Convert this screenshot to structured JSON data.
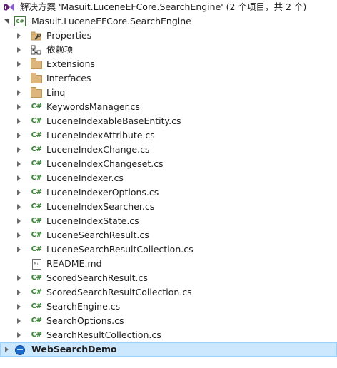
{
  "solution": {
    "label": "解决方案 'Masuit.LuceneEFCore.SearchEngine' (2 个项目，共 2 个)"
  },
  "project": {
    "label": "Masuit.LuceneEFCore.SearchEngine",
    "icon": "csharp-project-icon"
  },
  "nodes": [
    {
      "label": "Properties",
      "icon": "wrench-folder-icon"
    },
    {
      "label": "依赖项",
      "icon": "dependencies-icon"
    },
    {
      "label": "Extensions",
      "icon": "folder-icon"
    },
    {
      "label": "Interfaces",
      "icon": "folder-icon"
    },
    {
      "label": "Linq",
      "icon": "folder-icon"
    },
    {
      "label": "KeywordsManager.cs",
      "icon": "csharp-file-icon"
    },
    {
      "label": "LuceneIndexableBaseEntity.cs",
      "icon": "csharp-file-icon"
    },
    {
      "label": "LuceneIndexAttribute.cs",
      "icon": "csharp-file-icon"
    },
    {
      "label": "LuceneIndexChange.cs",
      "icon": "csharp-file-icon"
    },
    {
      "label": "LuceneIndexChangeset.cs",
      "icon": "csharp-file-icon"
    },
    {
      "label": "LuceneIndexer.cs",
      "icon": "csharp-file-icon"
    },
    {
      "label": "LuceneIndexerOptions.cs",
      "icon": "csharp-file-icon"
    },
    {
      "label": "LuceneIndexSearcher.cs",
      "icon": "csharp-file-icon"
    },
    {
      "label": "LuceneIndexState.cs",
      "icon": "csharp-file-icon"
    },
    {
      "label": "LuceneSearchResult.cs",
      "icon": "csharp-file-icon"
    },
    {
      "label": "LuceneSearchResultCollection.cs",
      "icon": "csharp-file-icon"
    },
    {
      "label": "README.md",
      "icon": "markdown-file-icon"
    },
    {
      "label": "ScoredSearchResult.cs",
      "icon": "csharp-file-icon"
    },
    {
      "label": "ScoredSearchResultCollection.cs",
      "icon": "csharp-file-icon"
    },
    {
      "label": "SearchEngine.cs",
      "icon": "csharp-file-icon"
    },
    {
      "label": "SearchOptions.cs",
      "icon": "csharp-file-icon"
    },
    {
      "label": "SearchResultCollection.cs",
      "icon": "csharp-file-icon"
    }
  ],
  "second_project": {
    "label": "WebSearchDemo",
    "icon": "web-project-icon"
  },
  "colors": {
    "selection_bg": "#cce8ff",
    "selection_border": "#99d1ff",
    "csharp_green": "#388a34",
    "folder": "#dcb67a"
  }
}
